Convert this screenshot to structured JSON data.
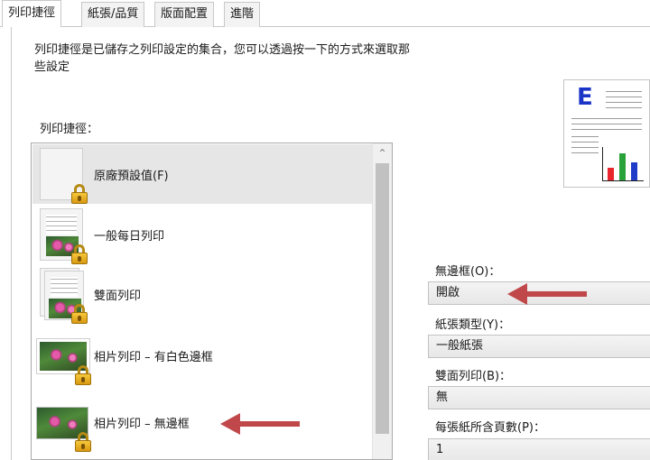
{
  "tabs": [
    {
      "label": "列印捷徑"
    },
    {
      "label": "紙張/品質"
    },
    {
      "label": "版面配置"
    },
    {
      "label": "進階"
    }
  ],
  "description": "列印捷徑是已儲存之列印設定的集合，您可以透過按一下的方式來選取那些設定",
  "shortcuts_label": "列印捷徑：",
  "shortcuts": [
    {
      "label": "原廠預設值(F)",
      "icon": "blank-document-icon",
      "selected": true
    },
    {
      "label": "一般每日列印",
      "icon": "photo-document-icon"
    },
    {
      "label": "雙面列印",
      "icon": "two-sided-document-icon"
    },
    {
      "label": "相片列印 – 有白色邊框",
      "icon": "bordered-photo-icon"
    },
    {
      "label": "相片列印 – 無邊框",
      "icon": "borderless-photo-icon"
    }
  ],
  "settings": {
    "borderless": {
      "label": "無邊框(O)：",
      "value": "開啟"
    },
    "paper_type": {
      "label": "紙張類型(Y)：",
      "value": "一般紙張"
    },
    "duplex": {
      "label": "雙面列印(B)：",
      "value": "無"
    },
    "pages_per_sheet": {
      "label": "每張紙所含頁數(P)：",
      "value": "1"
    }
  },
  "colors": {
    "annotation_arrow": "#c0484a",
    "preview_letter": "#1a34c8",
    "preview_bars": [
      "#e8262b",
      "#2aa23a",
      "#1f3cc8"
    ]
  }
}
